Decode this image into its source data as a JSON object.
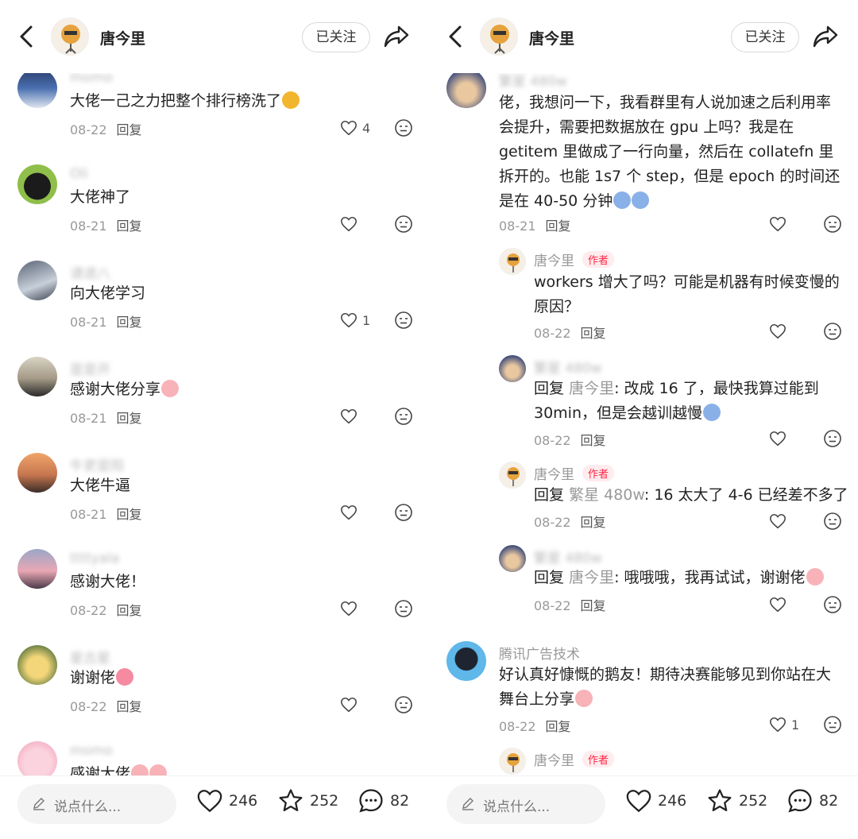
{
  "left": {
    "header": {
      "name": "唐今里",
      "follow": "已关注"
    },
    "comments": [
      {
        "name": "momo",
        "text": "大佬一己之力把整个排行榜洗了",
        "date": "08-22",
        "reply": "回复",
        "likes": "4"
      },
      {
        "name": "Oli",
        "text": "大佬神了",
        "date": "08-21",
        "reply": "回复",
        "likes": ""
      },
      {
        "name": "请退八",
        "text": "向大佬学习",
        "date": "08-21",
        "reply": "回复",
        "likes": "1"
      },
      {
        "name": "是是开",
        "text": "感谢大佬分享",
        "date": "08-21",
        "reply": "回复",
        "likes": ""
      },
      {
        "name": "牛吏是阳",
        "text": "大佬牛逼",
        "date": "08-21",
        "reply": "回复",
        "likes": ""
      },
      {
        "name": "ttttyala",
        "text": "感谢大佬！",
        "date": "08-22",
        "reply": "回复",
        "likes": ""
      },
      {
        "name": "星古星",
        "text": "谢谢佬",
        "date": "08-22",
        "reply": "回复",
        "likes": ""
      },
      {
        "name": "momo",
        "text": "感谢大佬",
        "date": "",
        "reply": "",
        "likes": ""
      }
    ],
    "bottom": {
      "placeholder": "说点什么...",
      "likes": "246",
      "stars": "252",
      "comments": "82"
    }
  },
  "right": {
    "header": {
      "name": "唐今里",
      "follow": "已关注"
    },
    "comments": [
      {
        "name": "繁星 480w",
        "text": "佬，我想问一下，我看群里有人说加速之后利用率会提升，需要把数据放在 gpu 上吗？我是在 getitem 里做成了一行向量，然后在 collatefn 里拆开的。也能 1s7 个 step，但是 epoch 的时间还是在 40-50 分钟",
        "date": "08-21",
        "reply": "回复",
        "likes": ""
      },
      {
        "name": "唐今里",
        "tag": "作者",
        "text": "workers 增大了吗？可能是机器有时候变慢的原因？",
        "date": "08-22",
        "reply": "回复",
        "likes": ""
      },
      {
        "name": "繁星 480w",
        "reply_prefix": "回复",
        "reply_to": "唐今里",
        "text": ": 改成 16 了，最快我算过能到 30min，但是会越训越慢",
        "date": "08-22",
        "reply": "回复",
        "likes": ""
      },
      {
        "name": "唐今里",
        "tag": "作者",
        "reply_prefix": "回复",
        "reply_to": "繁星 480w",
        "text": ": 16 太大了 4-6 已经差不多了",
        "date": "08-22",
        "reply": "回复",
        "likes": ""
      },
      {
        "name": "繁星 480w",
        "reply_prefix": "回复",
        "reply_to": "唐今里",
        "text": ": 哦哦哦，我再试试，谢谢佬",
        "date": "08-22",
        "reply": "回复",
        "likes": ""
      },
      {
        "name": "腾讯广告技术",
        "text": "好认真好慷慨的鹅友！期待决赛能够见到你站在大舞台上分享",
        "date": "08-22",
        "reply": "回复",
        "likes": "1"
      },
      {
        "name": "唐今里",
        "tag": "作者",
        "text": ""
      }
    ],
    "bottom": {
      "placeholder": "说点什么...",
      "likes": "246",
      "stars": "252",
      "comments": "82"
    }
  },
  "colors": {
    "accent": "#ff2442",
    "muted": "#999999",
    "text": "#222222"
  },
  "icons": [
    "back-icon",
    "share-icon",
    "heart-icon",
    "star-icon",
    "comment-bubble-icon",
    "dislike-face-icon",
    "pen-icon"
  ]
}
